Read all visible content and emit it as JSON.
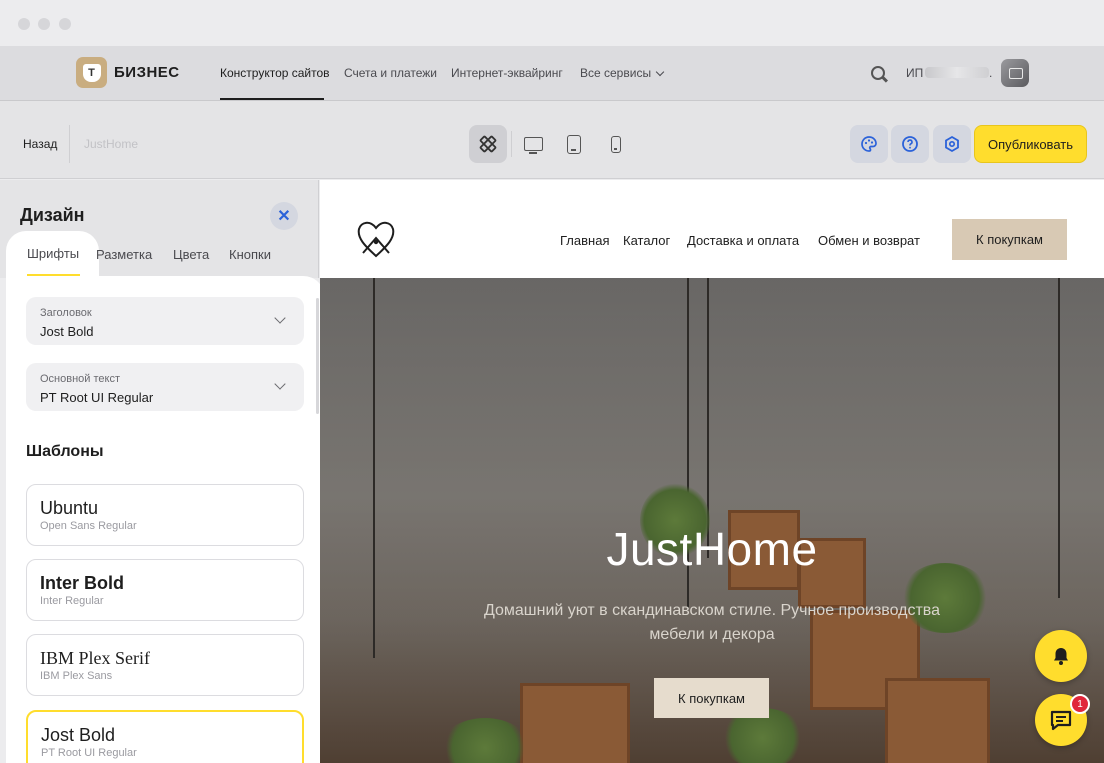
{
  "topnav": {
    "logo_glyph": "Т",
    "logo_text": "БИЗНЕС",
    "links": [
      {
        "label": "Конструктор сайтов"
      },
      {
        "label": "Счета и платежи"
      },
      {
        "label": "Интернет-эквайринг"
      },
      {
        "label": "Все сервисы"
      }
    ],
    "user_prefix": "ИП",
    "user_suffix": "."
  },
  "toolbar": {
    "back_label": "Назад",
    "site_name": "JustHome",
    "publish_label": "Опубликовать"
  },
  "panel": {
    "title": "Дизайн",
    "close_glyph": "✕",
    "tabs": [
      "Шрифты",
      "Разметка",
      "Цвета",
      "Кнопки"
    ],
    "heading_select": {
      "label": "Заголовок",
      "value": "Jost Bold"
    },
    "body_select": {
      "label": "Основной текст",
      "value": "PT Root UI Regular"
    },
    "templates_title": "Шаблоны",
    "templates": [
      {
        "name": "Ubuntu",
        "sub": "Open Sans Regular"
      },
      {
        "name": "Inter Bold",
        "sub": "Inter Regular"
      },
      {
        "name": "IBM Plex Serif",
        "sub": "IBM Plex Sans"
      },
      {
        "name": "Jost Bold",
        "sub": "PT Root UI Regular",
        "selected": true
      }
    ]
  },
  "site": {
    "nav": [
      "Главная",
      "Каталог",
      "Доставка и оплата",
      "Обмен и возврат"
    ],
    "cta_label": "К покупкам",
    "hero_title": "JustHome",
    "hero_subtitle": "Домашний уют в скандинавском стиле. Ручное производства мебели и декора",
    "hero_button": "К покупкам"
  },
  "chat_badge": "1",
  "colors": {
    "accent_yellow": "#ffdd2d",
    "brand_beige": "#c9ad80",
    "cta_beige": "#d8c9b4",
    "badge_red": "#e0263a",
    "icon_blue": "#2b62d9"
  }
}
